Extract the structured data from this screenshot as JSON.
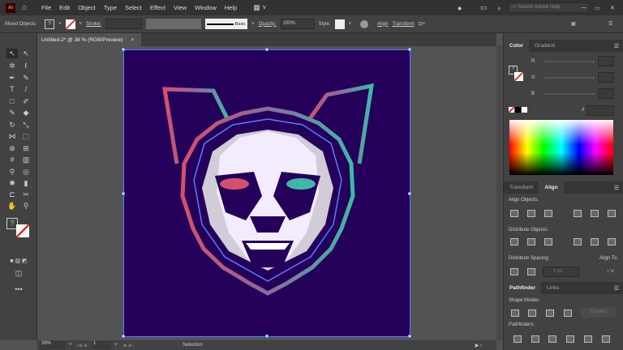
{
  "app": {
    "logo": "Ai"
  },
  "menu": [
    "File",
    "Edit",
    "Object",
    "Type",
    "Select",
    "Effect",
    "View",
    "Window",
    "Help"
  ],
  "search": {
    "placeholder": "Search Adobe Help"
  },
  "control": {
    "selection_label": "Mixed Objects",
    "fill_value": "?",
    "stroke_label": "Stroke:",
    "brush_label": "Basic",
    "opacity_label": "Opacity:",
    "opacity_value": "100%",
    "style_label": "Style:",
    "align_label": "Align",
    "transform_label": "Transform"
  },
  "document_tab": {
    "title": "Untitled-2* @ 38 % (RGB/Preview)",
    "close": "×"
  },
  "color_panel": {
    "tabs": [
      "Color",
      "Gradient"
    ],
    "channels": [
      "R",
      "G",
      "B"
    ],
    "hex_label": "#"
  },
  "align_panel": {
    "tabs": [
      "Transform",
      "Align"
    ],
    "align_objects": "Align Objects:",
    "distribute_objects": "Distribute Objects:",
    "distribute_spacing": "Distribute Spacing:",
    "align_to": "Align To:",
    "spacing_value": "0 px"
  },
  "pathfinder_panel": {
    "tabs": [
      "Pathfinder",
      "Links"
    ],
    "shape_modes": "Shape Modes:",
    "expand": "Expand",
    "pathfinders": "Pathfinders:"
  },
  "status": {
    "zoom": "38%",
    "page": "1",
    "tool": "Selection"
  },
  "colors": {
    "artboard": "#24005a",
    "pink": "#d4506f",
    "teal": "#3fb8a8",
    "face": "#f3ecff"
  }
}
